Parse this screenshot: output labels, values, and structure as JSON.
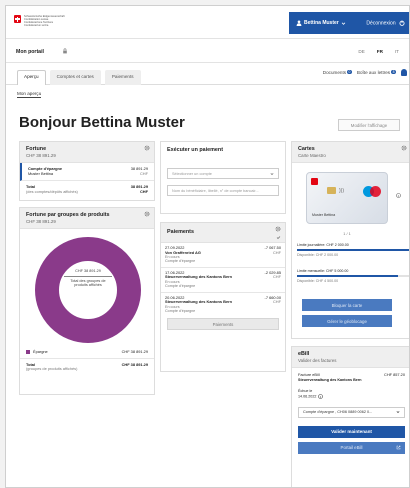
{
  "logo_lines": [
    "Schweizerische Eidgenossenschaft",
    "Confédération suisse",
    "Confederazione Svizzera",
    "Confederaziun svizra"
  ],
  "header": {
    "user_label": "Bettina Muster",
    "logout_label": "Déconnexion"
  },
  "portal": {
    "title": "Mon portail",
    "languages": [
      "DE",
      "FR",
      "IT"
    ],
    "active_language": "FR"
  },
  "tabs": [
    "Aperçu",
    "Comptes et cartes",
    "Paiements"
  ],
  "tabbar_right": {
    "documents_label": "Documents",
    "documents_count": "0",
    "inbox_label": "Boîte aux lettres",
    "inbox_count": "8"
  },
  "breadcrumb": "Mon aperçu",
  "greeting": "Bonjour Bettina Muster",
  "modify_button": "Modifier l'affichage",
  "fortune": {
    "title": "Fortune",
    "amount": "CHF 38 891.29",
    "account_name": "Compte d'épargne",
    "account_holder": "Muster Bettina",
    "account_amount": "38 891.29",
    "account_currency": "CHF",
    "total_label": "Total",
    "total_sub": "(des comptes/dépôts affichés)",
    "total_amount": "38 891.29",
    "total_currency": "CHF"
  },
  "groups": {
    "title": "Fortune par groupes de produits",
    "amount": "CHF 38 891.29",
    "donut_amount": "CHF 38 891.29",
    "donut_caption": "Total des groupes de produits affichés",
    "legend_label": "Épargne",
    "legend_amount": "CHF 38 891.29",
    "total_label": "Total",
    "total_sub": "(groupes de produits affichés)",
    "total_amount": "CHF 38 891.29",
    "color": "#8a3a8a"
  },
  "exec_payment": {
    "title": "Exécuter un paiement",
    "account_placeholder": "Sélectionner un compte",
    "search_placeholder": "Nom du bénéficiaire, libellé, n° de compte bancair..."
  },
  "payments": {
    "title": "Paiements",
    "items": [
      {
        "date": "27.09.2022",
        "name": "Von Graffenried AG",
        "status": "En cours",
        "account": "Compte d'épargne",
        "amount": "-7 067.50",
        "currency": "CHF"
      },
      {
        "date": "17.06.2022",
        "name": "Steuerverwaltung des Kantons Bern",
        "status": "En cours",
        "account": "Compte d'épargne",
        "amount": "-2 029.85",
        "currency": "CHF"
      },
      {
        "date": "20.06.2022",
        "name": "Steuerverwaltung des Kantons Bern",
        "status": "En cours",
        "account": "Compte d'épargne",
        "amount": "-7 660.00",
        "currency": "CHF"
      }
    ],
    "button": "Paiements"
  },
  "cards": {
    "title": "Cartes",
    "subtitle": "Carte Maestro",
    "card_holder": "Muster Bettina",
    "pager": "1 / 1",
    "daily_limit": "Limite journalière: CHF 2 000.00",
    "daily_available": "Disponible: CHF 2 000.00",
    "daily_fill": 1.0,
    "monthly_limit": "Limite mensuelle: CHF 5 000.00",
    "monthly_available": "Disponible: CHF 4 500.00",
    "monthly_fill": 0.9,
    "block_button": "Bloquer la carte",
    "geo_button": "Gérer le géoblocage"
  },
  "ebill": {
    "title": "eBill",
    "subtitle": "Valider des factures",
    "invoice_label": "Facture eBill",
    "invoice_amount": "CHF 857.20",
    "biller": "Steuerverwaltung des Kantons Bern",
    "due_label": "Échue le",
    "due_date": "14.06.2022",
    "account_select": "Compte d'épargne , CH06 0889 0062 0...",
    "validate_button": "Valider maintenant",
    "portal_button": "Portail eBill"
  },
  "colors": {
    "primary": "#1f56a6",
    "donut": "#8a3a8a",
    "swiss_red": "#e30613"
  }
}
